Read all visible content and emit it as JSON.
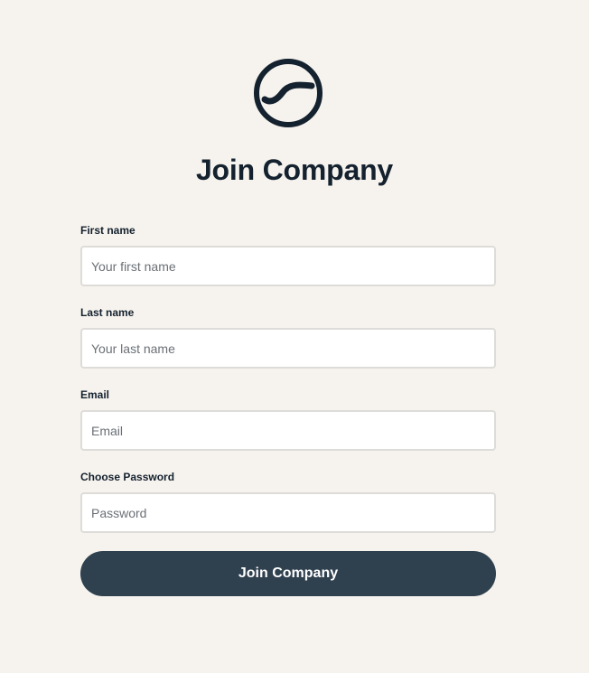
{
  "logo": {
    "icon": "company-logo-icon",
    "color": "#14212e"
  },
  "title": "Join Company",
  "form": {
    "first_name": {
      "label": "First name",
      "placeholder": "Your first name"
    },
    "last_name": {
      "label": "Last name",
      "placeholder": "Your last name"
    },
    "email": {
      "label": "Email",
      "placeholder": "Email"
    },
    "password": {
      "label": "Choose Password",
      "placeholder": "Password"
    },
    "submit_label": "Join Company"
  },
  "colors": {
    "background": "#f6f3ee",
    "button": "#2f404f",
    "text": "#14212e",
    "input_border": "#dedcd9"
  }
}
